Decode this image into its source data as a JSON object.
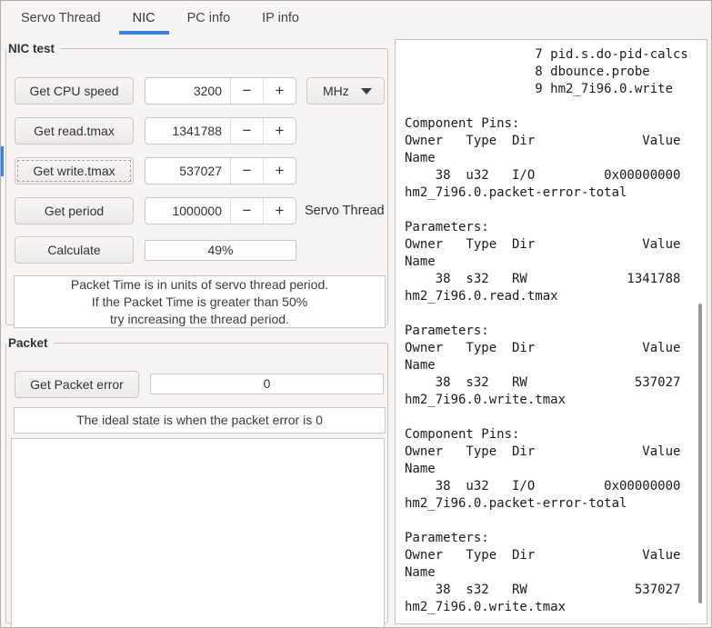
{
  "colors": {
    "accent": "#3584e4",
    "window_bg": "#f6f5f4",
    "panel_bg": "#ffffff"
  },
  "tabs": {
    "items": [
      {
        "label": "Servo Thread",
        "active": false
      },
      {
        "label": "NIC",
        "active": true
      },
      {
        "label": "PC info",
        "active": false
      },
      {
        "label": "IP info",
        "active": false
      }
    ]
  },
  "spin": {
    "minus": "−",
    "plus": "+"
  },
  "nic_test": {
    "title": "NIC test",
    "rows": [
      {
        "button": "Get CPU speed",
        "value": "3200"
      },
      {
        "button": "Get read.tmax",
        "value": "1341788"
      },
      {
        "button": "Get write.tmax",
        "value": "537027"
      },
      {
        "button": "Get period",
        "value": "1000000"
      }
    ],
    "unit_dropdown": {
      "selected": "MHz"
    },
    "period_label": "Servo Thread",
    "calculate_button": "Calculate",
    "packet_time_percent": "49%",
    "hint_line1": "Packet Time is in units of servo thread period.",
    "hint_line2": "If the Packet Time is greater than 50%",
    "hint_line3": "try increasing the thread period."
  },
  "packet": {
    "title": "Packet",
    "button": "Get Packet error",
    "error_value": "0",
    "hint": "The ideal state is when the packet error is 0"
  },
  "output": {
    "text": "                 7 pid.s.do-pid-calcs\n                 8 dbounce.probe\n                 9 hm2_7i96.0.write\n\nComponent Pins:\nOwner   Type  Dir              Value\nName\n    38  u32   I/O         0x00000000\nhm2_7i96.0.packet-error-total\n\nParameters:\nOwner   Type  Dir              Value\nName\n    38  s32   RW             1341788\nhm2_7i96.0.read.tmax\n\nParameters:\nOwner   Type  Dir              Value\nName\n    38  s32   RW              537027\nhm2_7i96.0.write.tmax\n\nComponent Pins:\nOwner   Type  Dir              Value\nName\n    38  u32   I/O         0x00000000\nhm2_7i96.0.packet-error-total\n\nParameters:\nOwner   Type  Dir              Value\nName\n    38  s32   RW              537027\nhm2_7i96.0.write.tmax"
  }
}
